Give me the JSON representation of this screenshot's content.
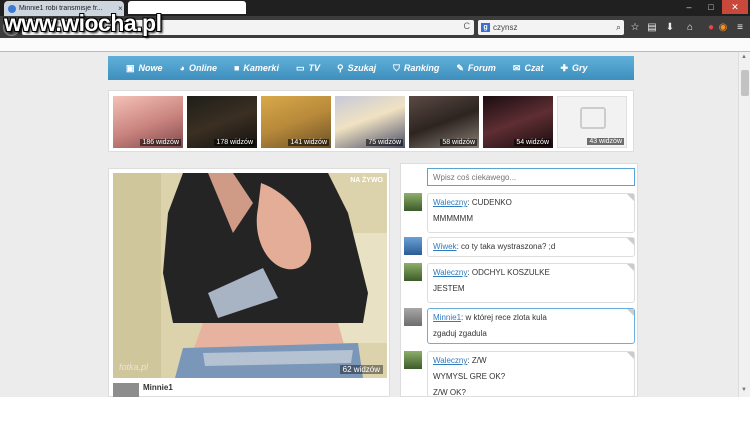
{
  "browser": {
    "tab_title": "Minnie1 robi transmisje fr...",
    "tab_close": "×",
    "window_controls": {
      "minimize": "–",
      "maximize": "□",
      "close": "✕"
    },
    "back": "←",
    "reload": "C",
    "search_engine_icon": "g",
    "search_text": "czynsz",
    "search_go": "⌕",
    "toolbar_icons": [
      "star-icon",
      "bookmark-list-icon",
      "download-icon",
      "home-icon",
      "addon-icon",
      "firefox-icon",
      "menu-icon"
    ]
  },
  "watermark": "www.wiocha.pl",
  "menu": {
    "items": [
      {
        "label": "Nowe",
        "icon": "image-icon"
      },
      {
        "label": "Online",
        "icon": "globe-icon"
      },
      {
        "label": "Kamerki",
        "icon": "camera-icon"
      },
      {
        "label": "TV",
        "icon": "tv-icon"
      },
      {
        "label": "Szukaj",
        "icon": "search-icon"
      },
      {
        "label": "Ranking",
        "icon": "shield-icon"
      },
      {
        "label": "Forum",
        "icon": "pencil-icon"
      },
      {
        "label": "Czat",
        "icon": "chat-icon"
      },
      {
        "label": "Gry",
        "icon": "gamepad-icon"
      }
    ]
  },
  "thumbnails": [
    {
      "viewers": "186 widzów"
    },
    {
      "viewers": "178 widzów"
    },
    {
      "viewers": "141 widzów"
    },
    {
      "viewers": "75 widzów"
    },
    {
      "viewers": "58 widzów"
    },
    {
      "viewers": "54 widzów"
    },
    {
      "viewers": "43 widzów"
    }
  ],
  "video": {
    "live_badge": "NA ŻYWO",
    "viewers": "62 widzów",
    "logo": "fotka.pl",
    "streamer": "Minnie1"
  },
  "chat": {
    "input_placeholder": "Wpisz coś ciekawego...",
    "messages": [
      {
        "user": "Waleczny",
        "lines": [
          "CUDENKO",
          "MMMMMM"
        ]
      },
      {
        "user": "Wiwek",
        "lines": [
          "co ty taka wystraszona? ;d"
        ]
      },
      {
        "user": "Waleczny",
        "lines": [
          "ODCHYL KOSZULKE",
          "JESTEM"
        ]
      },
      {
        "user": "Minnie1",
        "lines": [
          "w której rece zlota kula",
          "zgaduj zgadula"
        ]
      },
      {
        "user": "Waleczny",
        "lines": [
          "Z/W",
          "WYMYSL GRE OK?",
          "Z/W OK?"
        ]
      }
    ]
  },
  "colors": {
    "menu_bar": "#4a9ccb",
    "chat_username": "#2e7bbf",
    "chat_highlight_border": "#6ab0df"
  }
}
